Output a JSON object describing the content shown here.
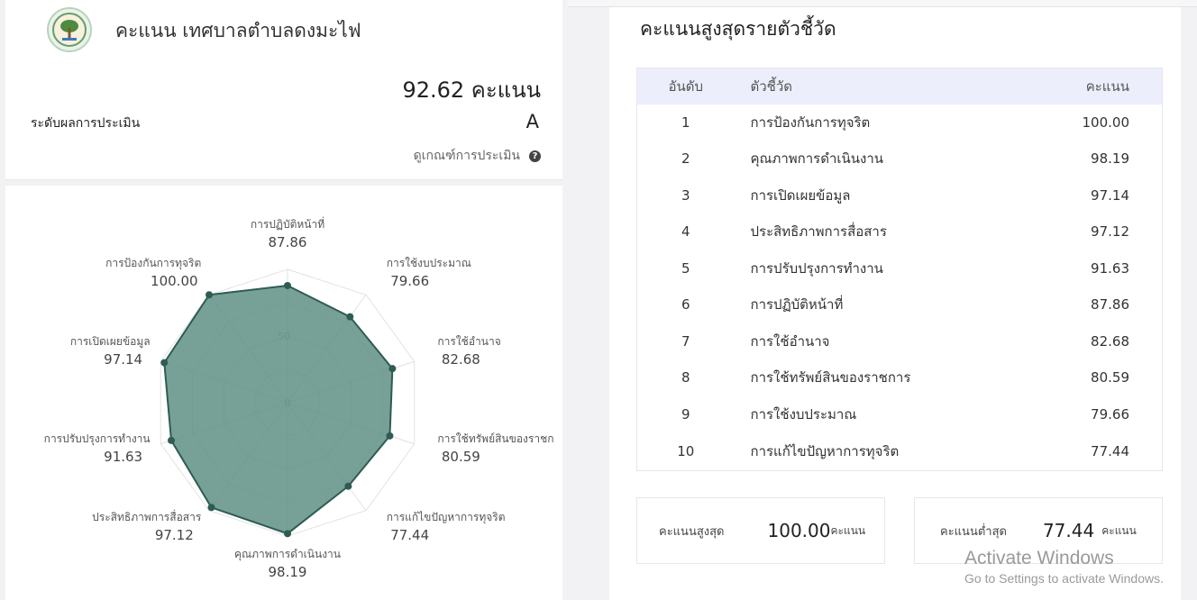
{
  "header": {
    "title": "คะแนน เทศบาลตำบลดงมะไฟ",
    "total_score": "92.62 คะแนน",
    "grade_label": "ระดับผลการประเมิน",
    "grade_value": "A",
    "criteria_link": "ดูเกณฑ์การประเมิน"
  },
  "radar": {
    "scale_labels": [
      "50",
      "0"
    ],
    "axes": [
      {
        "label": "การปฏิบัติหน้าที่",
        "value": "87.86",
        "score": 87.86
      },
      {
        "label": "การใช้งบประมาณ",
        "value": "79.66",
        "score": 79.66
      },
      {
        "label": "การใช้อำนาจ",
        "value": "82.68",
        "score": 82.68
      },
      {
        "label": "การใช้ทรัพย์สินของราชก",
        "value": "80.59",
        "score": 80.59
      },
      {
        "label": "การแก้ไขปัญหาการทุจริต",
        "value": "77.44",
        "score": 77.44
      },
      {
        "label": "คุณภาพการดำเนินงาน",
        "value": "98.19",
        "score": 98.19
      },
      {
        "label": "ประสิทธิภาพการสื่อสาร",
        "value": "97.12",
        "score": 97.12
      },
      {
        "label": "การปรับปรุงการทำงาน",
        "value": "91.63",
        "score": 91.63
      },
      {
        "label": "การเปิดเผยข้อมูล",
        "value": "97.14",
        "score": 97.14
      },
      {
        "label": "การป้องกันการทุจริต",
        "value": "100.00",
        "score": 100.0
      }
    ],
    "colors": {
      "fill": "#5f8f85",
      "stroke": "#2e5c52",
      "grid": "#e2e2e2"
    }
  },
  "ranking": {
    "title": "คะแนนสูงสุดรายตัวชี้วัด",
    "headers": {
      "rank": "อันดับ",
      "indicator": "ตัวชี้วัด",
      "score": "คะแนน"
    },
    "rows": [
      {
        "rank": "1",
        "indicator": "การป้องกันการทุจริต",
        "score": "100.00"
      },
      {
        "rank": "2",
        "indicator": "คุณภาพการดำเนินงาน",
        "score": "98.19"
      },
      {
        "rank": "3",
        "indicator": "การเปิดเผยข้อมูล",
        "score": "97.14"
      },
      {
        "rank": "4",
        "indicator": "ประสิทธิภาพการสื่อสาร",
        "score": "97.12"
      },
      {
        "rank": "5",
        "indicator": "การปรับปรุงการทำงาน",
        "score": "91.63"
      },
      {
        "rank": "6",
        "indicator": "การปฏิบัติหน้าที่",
        "score": "87.86"
      },
      {
        "rank": "7",
        "indicator": "การใช้อำนาจ",
        "score": "82.68"
      },
      {
        "rank": "8",
        "indicator": "การใช้ทรัพย์สินของราชการ",
        "score": "80.59"
      },
      {
        "rank": "9",
        "indicator": "การใช้งบประมาณ",
        "score": "79.66"
      },
      {
        "rank": "10",
        "indicator": "การแก้ไขปัญหาการทุจริต",
        "score": "77.44"
      }
    ]
  },
  "stats": {
    "max": {
      "label": "คะแนนสูงสุด",
      "value": "100.00",
      "unit": "คะแนน"
    },
    "min": {
      "label": "คะแนนต่ำสุด",
      "value": "77.44",
      "unit": "คะแนน"
    }
  },
  "watermark": {
    "line1": "Activate Windows",
    "line2": "Go to Settings to activate Windows."
  }
}
